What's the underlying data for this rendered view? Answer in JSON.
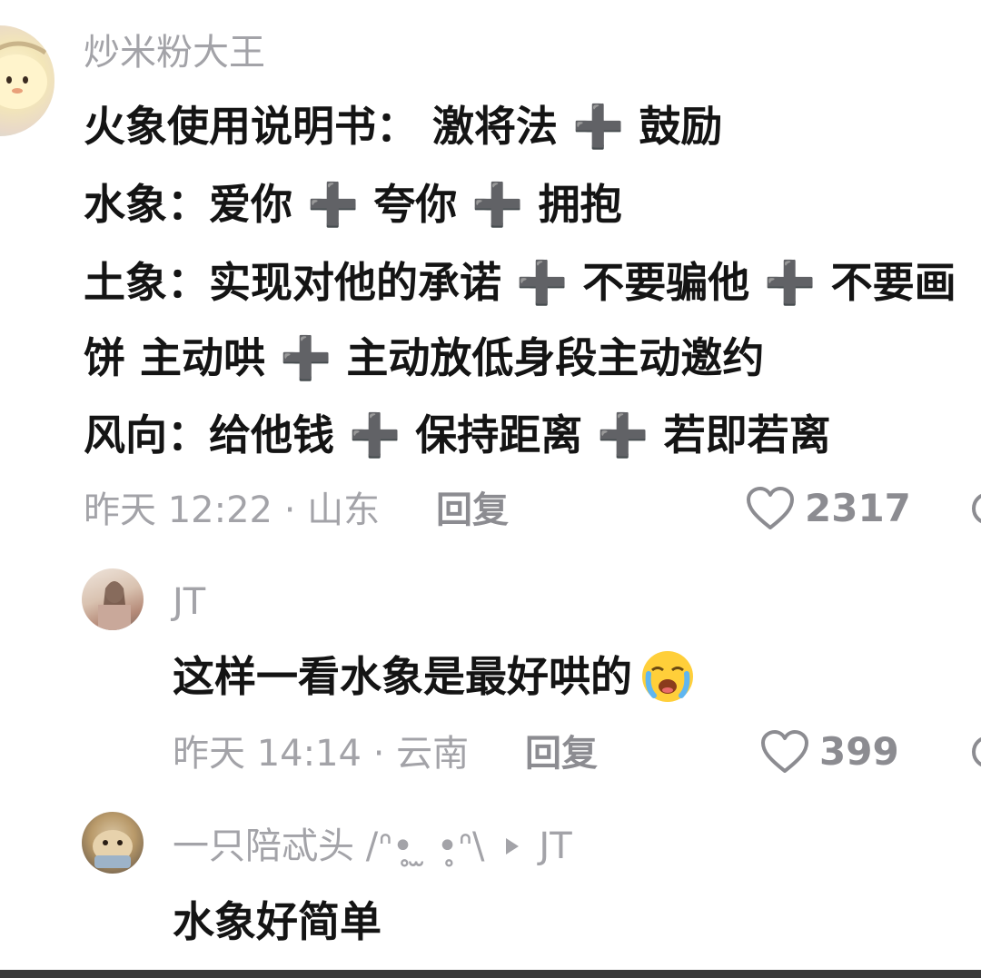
{
  "comments": [
    {
      "username": "炒米粉大王",
      "lines": [
        "火象使用说明书： 激将法 ➕ 鼓励",
        "水象：爱你 ➕ 夸你 ➕ 拥抱",
        "土象：实现对他的承诺 ➕ 不要骗他 ➕ 不要画",
        "饼 主动哄 ➕ 主动放低身段主动邀约",
        "风向：给他钱 ➕ 保持距离 ➕ 若即若离"
      ],
      "time_location": "昨天 12:22 · 山东",
      "reply_label": "回复",
      "likes": "2317"
    },
    {
      "username": "JT",
      "text": "这样一看水象是最好哄的",
      "emoji": "loudly-crying-emoji",
      "time_location": "昨天 14:14 · 云南",
      "reply_label": "回复",
      "likes": "399"
    },
    {
      "username": "一只陪忒头 /ᐢ•̥ ̫ •̥ᐢ\\",
      "reply_to": "JT",
      "text": "水象好简单"
    }
  ],
  "icons": {
    "like": "heart-outline-icon",
    "reply_arrow": "triangle-right-icon"
  },
  "colors": {
    "text": "#141414",
    "muted": "#a3a3a8",
    "action": "#8c8c91"
  }
}
